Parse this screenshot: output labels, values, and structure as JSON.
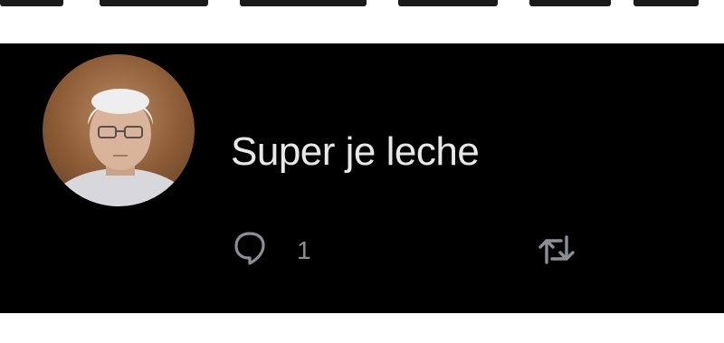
{
  "post": {
    "text": "Super je leche",
    "reply_count": "1"
  },
  "icons": {
    "reply": "speech-bubble-icon",
    "retweet": "retweet-icon"
  },
  "colors": {
    "card_background": "#000000",
    "text": "#e8e8e8",
    "icon": "#8b8f94"
  }
}
